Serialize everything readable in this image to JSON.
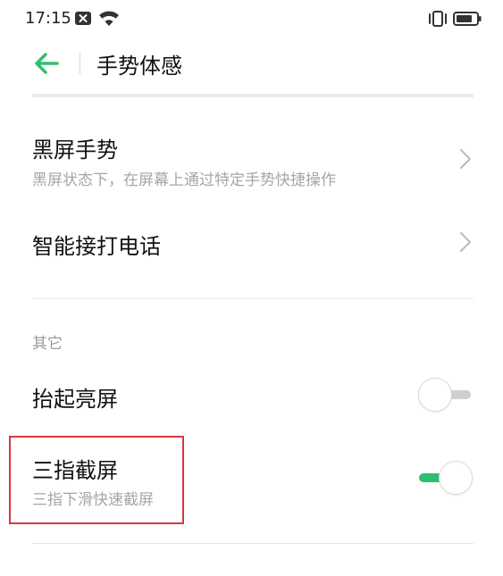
{
  "status_bar": {
    "time": "17:15"
  },
  "header": {
    "title": "手势体感"
  },
  "items": [
    {
      "title": "黑屏手势",
      "subtitle": "黑屏状态下，在屏幕上通过特定手势快捷操作"
    },
    {
      "title": "智能接打电话"
    }
  ],
  "section_other": {
    "label": "其它",
    "items": [
      {
        "title": "抬起亮屏",
        "toggle_on": false
      },
      {
        "title": "三指截屏",
        "subtitle": "三指下滑快速截屏",
        "toggle_on": true
      }
    ]
  },
  "colors": {
    "accent": "#2fbf71",
    "highlight": "#d9363e"
  }
}
